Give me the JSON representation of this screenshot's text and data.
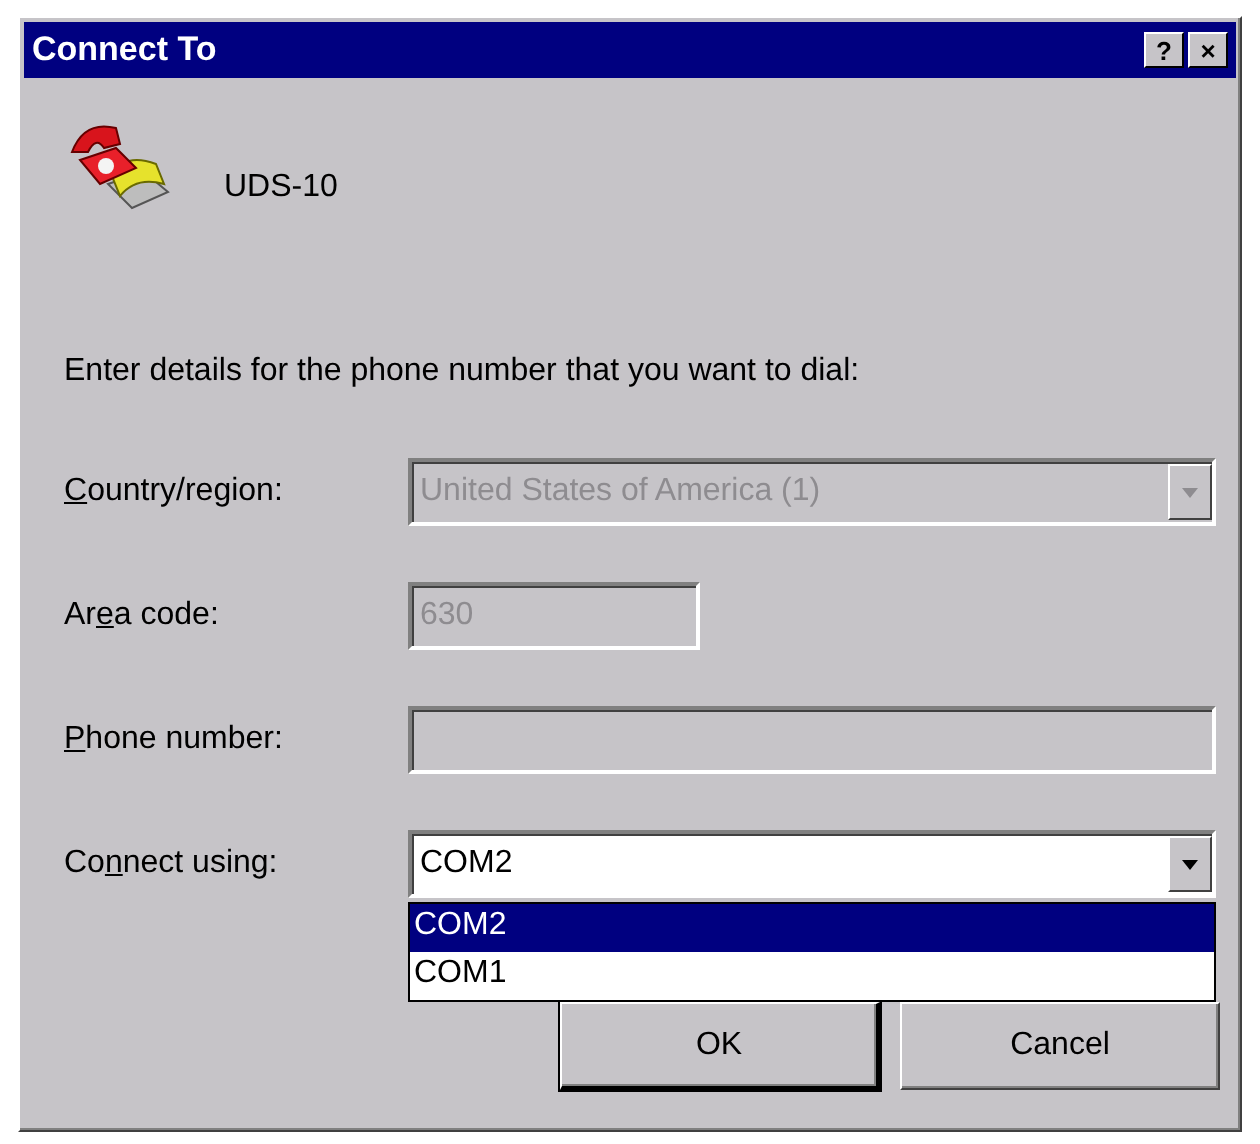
{
  "window": {
    "title": "Connect To",
    "title_buttons": [
      "?",
      "×"
    ]
  },
  "connection": {
    "name": "UDS-10"
  },
  "instructions": "Enter details for the phone number that you want to dial:",
  "fields": [
    {
      "kind": "dropdown",
      "label": {
        "key": "C",
        "after": "ountry/region:"
      },
      "value": "United States of America (1)",
      "disabled": true
    },
    {
      "kind": "short_text",
      "label": {
        "before": "Ar",
        "key": "e",
        "after": "a code:"
      },
      "value": "630",
      "disabled": true
    },
    {
      "kind": "text",
      "label": {
        "key": "P",
        "after": "hone number:"
      },
      "disabled": true
    },
    {
      "kind": "dropdown",
      "label": {
        "before": "Co",
        "key": "n",
        "after": "nect using:"
      },
      "value": "COM2",
      "disabled": false,
      "expanded": true,
      "options": [
        {
          "label": "COM2",
          "selected": true
        },
        {
          "label": "COM1",
          "selected": false
        }
      ]
    }
  ],
  "buttons": [
    {
      "label": "OK",
      "default": true
    },
    {
      "label": "Cancel",
      "default": false
    }
  ]
}
